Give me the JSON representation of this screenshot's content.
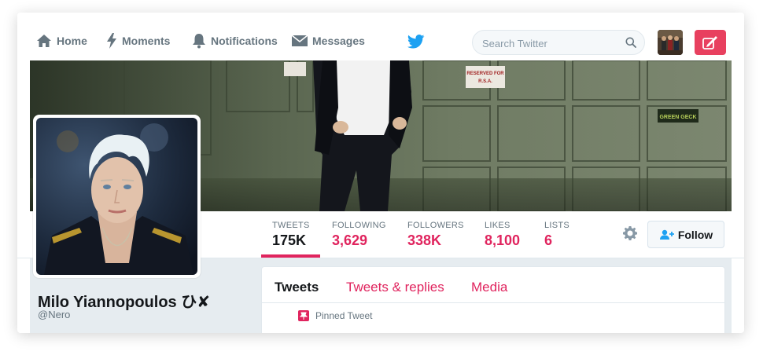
{
  "nav": {
    "home": "Home",
    "moments": "Moments",
    "notifications": "Notifications",
    "messages": "Messages"
  },
  "search": {
    "placeholder": "Search Twitter"
  },
  "colors": {
    "accent": "#e0245e",
    "twitter_blue": "#1da1f2",
    "muted": "#66757f"
  },
  "profile": {
    "name": "Milo Yiannopoulos ひ✘",
    "handle": "@Nero"
  },
  "stats": [
    {
      "label": "TWEETS",
      "value": "175K"
    },
    {
      "label": "FOLLOWING",
      "value": "3,629"
    },
    {
      "label": "FOLLOWERS",
      "value": "338K"
    },
    {
      "label": "LIKES",
      "value": "8,100"
    },
    {
      "label": "LISTS",
      "value": "6"
    }
  ],
  "actions": {
    "follow": "Follow"
  },
  "timeline": {
    "tabs": [
      "Tweets",
      "Tweets & replies",
      "Media"
    ],
    "pinned": "Pinned Tweet"
  },
  "banner_signs": {
    "sign1": "RESERVED FOR\nR.S.A.",
    "sign2": "GREEN GECK"
  }
}
